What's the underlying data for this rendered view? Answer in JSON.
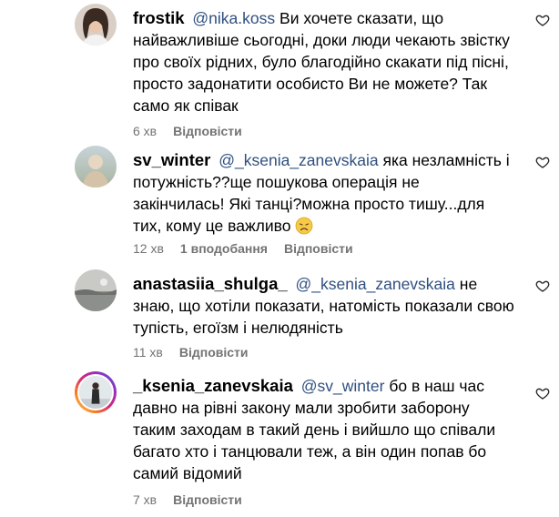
{
  "comments": [
    {
      "username": "frostik",
      "mention": "@nika.koss",
      "text": "Ви хочете сказати, що найважливіше сьогодні, доки люди чекають звістку про своїх рідних, було благодійно скакати під пісні, просто задонатити особисто Ви не можете? Так само як співак",
      "time": "6 хв",
      "likes": "",
      "reply_label": "Відповісти",
      "avatar_icon": "profile-photo"
    },
    {
      "username": "sv_winter",
      "mention": "@_ksenia_zanevskaia",
      "text": "яка незламність і потужність??ще пошукова операція не закінчилась! Які танці?можна просто тишу...для тих, кому це важливо",
      "emoji": "disappointed-face-emoji",
      "time": "12 хв",
      "likes": "1 вподобання",
      "reply_label": "Відповісти",
      "avatar_icon": "profile-photo"
    },
    {
      "username": "anastasiia_shulga_",
      "mention": "@_ksenia_zanevskaia",
      "text": "не знаю, що хотіли показати, натомість показали свою тупість, егоїзм і нелюдяність",
      "time": "11 хв",
      "likes": "",
      "reply_label": "Відповісти",
      "avatar_icon": "profile-photo"
    },
    {
      "username": "_ksenia_zanevskaia",
      "mention": "@sv_winter",
      "text": "бо в наш час давно на рівні закону мали зробити заборону таким заходам в такий день і вийшло що співали багато хто і танцювали теж, а він один попав бо самий відомий",
      "time": "7 хв",
      "likes": "",
      "reply_label": "Відповісти",
      "avatar_icon": "profile-photo-story-ring"
    }
  ],
  "colors": {
    "mention": "#2f4f7f",
    "meta": "#737373",
    "text": "#000000"
  }
}
